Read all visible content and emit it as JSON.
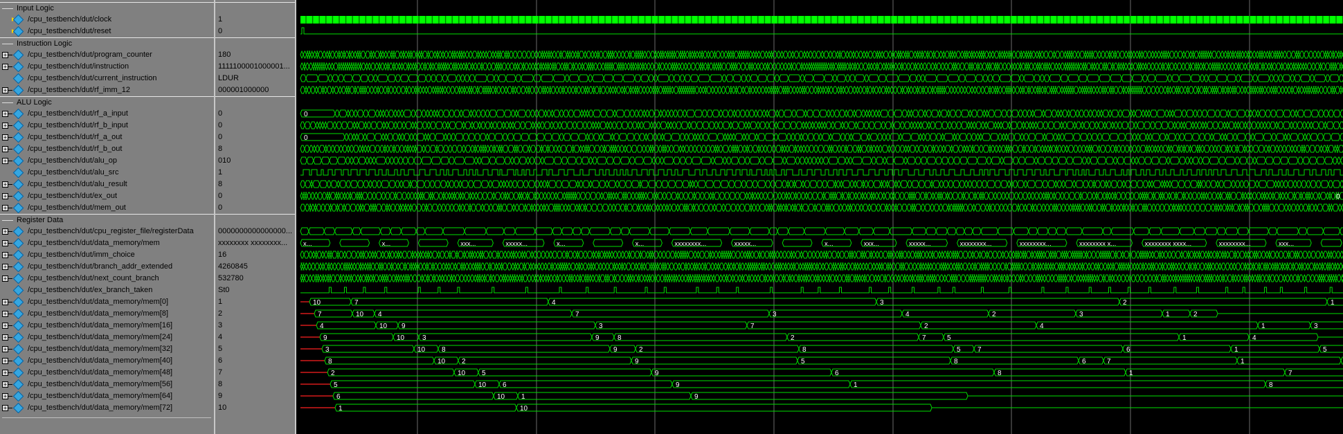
{
  "groups": {
    "input": "Input Logic",
    "instruction": "Instruction Logic",
    "alu": "ALU Logic",
    "register": "Register Data"
  },
  "signals": [
    {
      "name": "/cpu_testbench/dut/clock",
      "value": "1"
    },
    {
      "name": "/cpu_testbench/dut/reset",
      "value": "0"
    },
    {
      "name": "/cpu_testbench/dut/program_counter",
      "value": "180"
    },
    {
      "name": "/cpu_testbench/dut/instruction",
      "value": "1111100001000001..."
    },
    {
      "name": "/cpu_testbench/dut/current_instruction",
      "value": "LDUR"
    },
    {
      "name": "/cpu_testbench/dut/rf_imm_12",
      "value": "000001000000"
    },
    {
      "name": "/cpu_testbench/dut/rf_a_input",
      "value": "0"
    },
    {
      "name": "/cpu_testbench/dut/rf_b_input",
      "value": "0"
    },
    {
      "name": "/cpu_testbench/dut/rf_a_out",
      "value": "0"
    },
    {
      "name": "/cpu_testbench/dut/rf_b_out",
      "value": "8"
    },
    {
      "name": "/cpu_testbench/dut/alu_op",
      "value": "010"
    },
    {
      "name": "/cpu_testbench/dut/alu_src",
      "value": "1"
    },
    {
      "name": "/cpu_testbench/dut/alu_result",
      "value": "8"
    },
    {
      "name": "/cpu_testbench/dut/ex_out",
      "value": "0"
    },
    {
      "name": "/cpu_testbench/dut/mem_out",
      "value": "0"
    },
    {
      "name": "/cpu_testbench/dut/cpu_register_file/registerData",
      "value": "0000000000000000..."
    },
    {
      "name": "/cpu_testbench/dut/data_memory/mem",
      "value": "xxxxxxxx xxxxxxxx..."
    },
    {
      "name": "/cpu_testbench/dut/imm_choice",
      "value": "16"
    },
    {
      "name": "/cpu_testbench/dut/branch_addr_extended",
      "value": "4260845"
    },
    {
      "name": "/cpu_testbench/dut/next_count_branch",
      "value": "532780"
    },
    {
      "name": "/cpu_testbench/dut/ex_branch_taken",
      "value": "St0"
    },
    {
      "name": "/cpu_testbench/dut/data_memory/mem[0]",
      "value": "1"
    },
    {
      "name": "/cpu_testbench/dut/data_memory/mem[8]",
      "value": "2"
    },
    {
      "name": "/cpu_testbench/dut/data_memory/mem[16]",
      "value": "3"
    },
    {
      "name": "/cpu_testbench/dut/data_memory/mem[24]",
      "value": "4"
    },
    {
      "name": "/cpu_testbench/dut/data_memory/mem[32]",
      "value": "5"
    },
    {
      "name": "/cpu_testbench/dut/data_memory/mem[40]",
      "value": "6"
    },
    {
      "name": "/cpu_testbench/dut/data_memory/mem[48]",
      "value": "7"
    },
    {
      "name": "/cpu_testbench/dut/data_memory/mem[56]",
      "value": "8"
    },
    {
      "name": "/cpu_testbench/dut/data_memory/mem[64]",
      "value": "9"
    },
    {
      "name": "/cpu_testbench/dut/data_memory/mem[72]",
      "value": "10"
    }
  ],
  "wave_labels": {
    "pc_first": "0",
    "rf_a_input_first": "0",
    "rf_a_out_first": "0",
    "ex_out_tail": "0",
    "mem_bus": [
      "x...",
      "x...",
      "x...",
      "x...",
      "xxx...",
      "xxxxx...",
      "x...",
      "x...",
      "x...",
      "xxxxxxxx...",
      "xxxxx...",
      "x...",
      "x...",
      "xxx...",
      "xxxxx...",
      "xxxxxxxx...",
      "xxxxxxxx...",
      "xxxxxxxx x...",
      "xxxxxxxx xxxx...",
      "xxxxxxxx...",
      "xxx..."
    ],
    "mem_rows": [
      [
        "10",
        "7",
        "4",
        "3",
        "2",
        "1"
      ],
      [
        "7",
        "10",
        "4",
        "7",
        "3",
        "4",
        "2",
        "3",
        "1",
        "2"
      ],
      [
        "4",
        "10",
        "9",
        "3",
        "7",
        "2",
        "4",
        "1",
        "3"
      ],
      [
        "9",
        "10",
        "3",
        "9",
        "8",
        "2",
        "7",
        "5",
        "1",
        "4"
      ],
      [
        "3",
        "10",
        "8",
        "9",
        "2",
        "8",
        "5",
        "7",
        "6",
        "1",
        "5"
      ],
      [
        "8",
        "10",
        "2",
        "9",
        "5",
        "8",
        "6",
        "7",
        "1",
        "6"
      ],
      [
        "2",
        "10",
        "5",
        "9",
        "6",
        "8",
        "1",
        "7"
      ],
      [
        "5",
        "10",
        "6",
        "9",
        "1",
        "8"
      ],
      [
        "6",
        "10",
        "1",
        "9"
      ],
      [
        "1",
        "10"
      ]
    ]
  },
  "colors": {
    "wave": "#00e000",
    "clock": "#00ff00",
    "cursor": "#ffffff",
    "red": "#ff2020",
    "panel": "#808080"
  },
  "icons": {
    "input_signal": "arrow-in-diamond-icon",
    "bus_signal": "diamond-icon",
    "expand": "plus-expand-icon"
  }
}
